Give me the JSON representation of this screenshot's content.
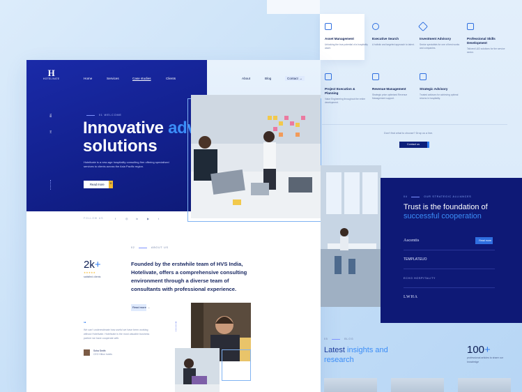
{
  "services": {
    "items": [
      {
        "title": "Asset Management",
        "desc": "Unlocking the true potential of a hospitality asset."
      },
      {
        "title": "Executive Search",
        "desc": "A holistic and targeted approach to talent."
      },
      {
        "title": "Investment Advisory",
        "desc": "Sector specialists for one of best works and companies."
      },
      {
        "title": "Professional Skills Development",
        "desc": "Tailored L&D solutions for the service sector."
      },
      {
        "title": "Project Execution & Planning",
        "desc": "Value Engineering throughout the entire development."
      },
      {
        "title": "Revenue Management",
        "desc": "Strategic price optimised Revenue Management support."
      },
      {
        "title": "Strategic Advisory",
        "desc": "Trusted advisors for achieving optimal returns in hospitality."
      }
    ],
    "question": "Don't find what to choose? Drop us a line.",
    "contact_button": "Contact us"
  },
  "header": {
    "logo_mark": "H",
    "logo_word": "HOTELIVATE",
    "nav": [
      "Home",
      "Services",
      "Case studies",
      "Clients"
    ],
    "nav_right": [
      "About",
      "Blog"
    ],
    "contact": "Contact"
  },
  "hero": {
    "side_tags": [
      "EN",
      "HI"
    ],
    "welcome": "WELCOME",
    "welcome_num": "01",
    "title_1": "Innovative",
    "title_accent": "advisory",
    "title_2": "solutions",
    "lead": "Hotelivate is a new-age hospitality consulting firm offering specialised services to clients across the Asia Pacific region.",
    "read_more": "Read more"
  },
  "follow": {
    "label": "FOLLOW US",
    "icons": [
      "facebook-icon",
      "instagram-icon",
      "linkedin-icon",
      "twitter-icon",
      "youtube-icon"
    ],
    "glyphs": [
      "f",
      "◎",
      "in",
      "▶",
      "t"
    ]
  },
  "about": {
    "tag_num": "02",
    "tag": "ABOUT US",
    "stat_value": "2k",
    "stat_plus": "+",
    "stars": "★★★★★",
    "stat_label": "satisfied clients",
    "text": "Founded by the erstwhile team of HVS India, Hotelivate, offers a comprehensive consulting environment through a diverse team of consultants with professional experience.",
    "read_more": "Read more",
    "quote_mark": "“",
    "quote": "We can't underestimate how useful we have been working without Hotelivate. Hotelivate is the most valuable business partner we have cooperate with.",
    "author_name": "Soha Smith",
    "author_role": "CEO Hilton hotels"
  },
  "trust": {
    "tag_num": "04",
    "tag": "OUR STRATEGIC ALLIANCES",
    "title_1": "Trust is the foundation of",
    "title_accent": "successful cooperation",
    "read_more": "Read more",
    "brands": [
      "Ascentis",
      "TEMPLATEUO",
      "ECHO HOSPITALITY",
      "LWHA"
    ]
  },
  "blog": {
    "tag_num": "05",
    "tag": "BLOG",
    "title_1": "Latest",
    "title_accent": "insights and",
    "title_2": "research",
    "stat_value": "100",
    "stat_plus": "+",
    "stat_label": "professional articles to share our knowledge"
  },
  "colors": {
    "navy": "#0e1976",
    "hero_blue": "#1a2aa8",
    "accent": "#3b8df7",
    "gold": "#f4b930"
  }
}
